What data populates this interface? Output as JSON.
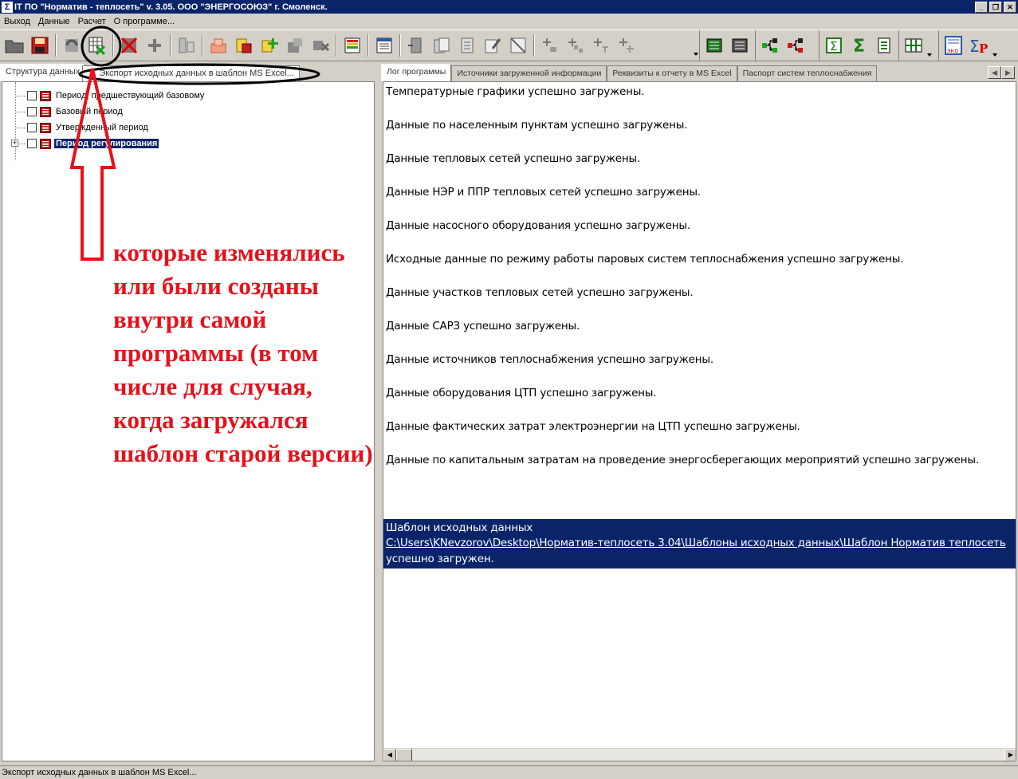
{
  "window": {
    "title": "IT ПО \"Норматив - теплосеть\" v. 3.05. ООО \"ЭНЕРГОСОЮЗ\" г. Смоленск.",
    "app_icon": "Σ"
  },
  "menu": {
    "items": [
      "Выход",
      "Данные",
      "Расчет",
      "О программе..."
    ]
  },
  "left_panel": {
    "tabs": [
      "Структура данных",
      "Экспорт исходных данных в шаблон MS Excel..."
    ],
    "tree": [
      {
        "label": "Период, предшествующий базовому"
      },
      {
        "label": "Базовый период"
      },
      {
        "label": "Утвержденный период"
      },
      {
        "label": "Период регулирования"
      }
    ]
  },
  "right_panel": {
    "tabs": [
      "Лог программы",
      "Источники загруженной информации",
      "Реквизиты к отчету в MS Excel",
      "Паспорт систем теплоснабжения"
    ],
    "log": [
      "Температурные графики успешно загружены.",
      "Данные по населенным пунктам успешно загружены.",
      "Данные тепловых сетей успешно загружены.",
      "Данные НЭР и ППР тепловых сетей успешно загружены.",
      "Данные насосного оборудования успешно загружены.",
      "Исходные данные по режиму работы паровых систем теплоснабжения успешно загружены.",
      "Данные участков тепловых сетей успешно загружены.",
      "Данные САРЗ успешно загружены.",
      "Данные источников теплоснабжения успешно загружены.",
      "Данные оборудования ЦТП успешно загружены.",
      "Данные фактических затрат электроэнергии на ЦТП успешно загружены.",
      "Данные по капитальным затратам на проведение энергосберегающих мероприятий успешно загружены."
    ],
    "highlight": {
      "line1": "Шаблон исходных данных",
      "path": "C:\\Users\\KNevzorov\\Desktop\\Норматив-теплосеть 3.04\\Шаблоны исходных данных\\Шаблон Норматив теплосеть",
      "line3": "успешно загружен."
    }
  },
  "status_bar": {
    "text": "Экспорт исходных данных в шаблон MS Excel..."
  },
  "annotation": {
    "text": "которые изменялись или были созданы внутри самой программы (в том числе для случая, когда загружался шаблон старой версии)",
    "color": "#e8101a"
  },
  "toolbar": {
    "icons": [
      "open-folder-icon",
      "save-icon",
      "refresh-icon",
      "export-excel-icon",
      "delete-grid-icon",
      "add-icon",
      "copy-structure-icon",
      "copy-boxes-icon",
      "import-db-icon",
      "add-green-icon",
      "move-icon",
      "remove-icon",
      "chart-bars-icon",
      "list-icon",
      "merge-docs-icon",
      "docs-icon",
      "docs-lines-icon",
      "edit-doc-icon",
      "cancel-doc-icon",
      "add-node-icon",
      "add-nodes-icon",
      "add-cross-icon",
      "add-branch-icon",
      "calc-db-icon",
      "calc-db2-icon",
      "tree-green-icon",
      "tree-red-icon",
      "sum-doc-icon",
      "sigma-icon",
      "report-icon",
      "grid-view-icon",
      "eco-report-icon",
      "sigma-p-icon"
    ]
  }
}
